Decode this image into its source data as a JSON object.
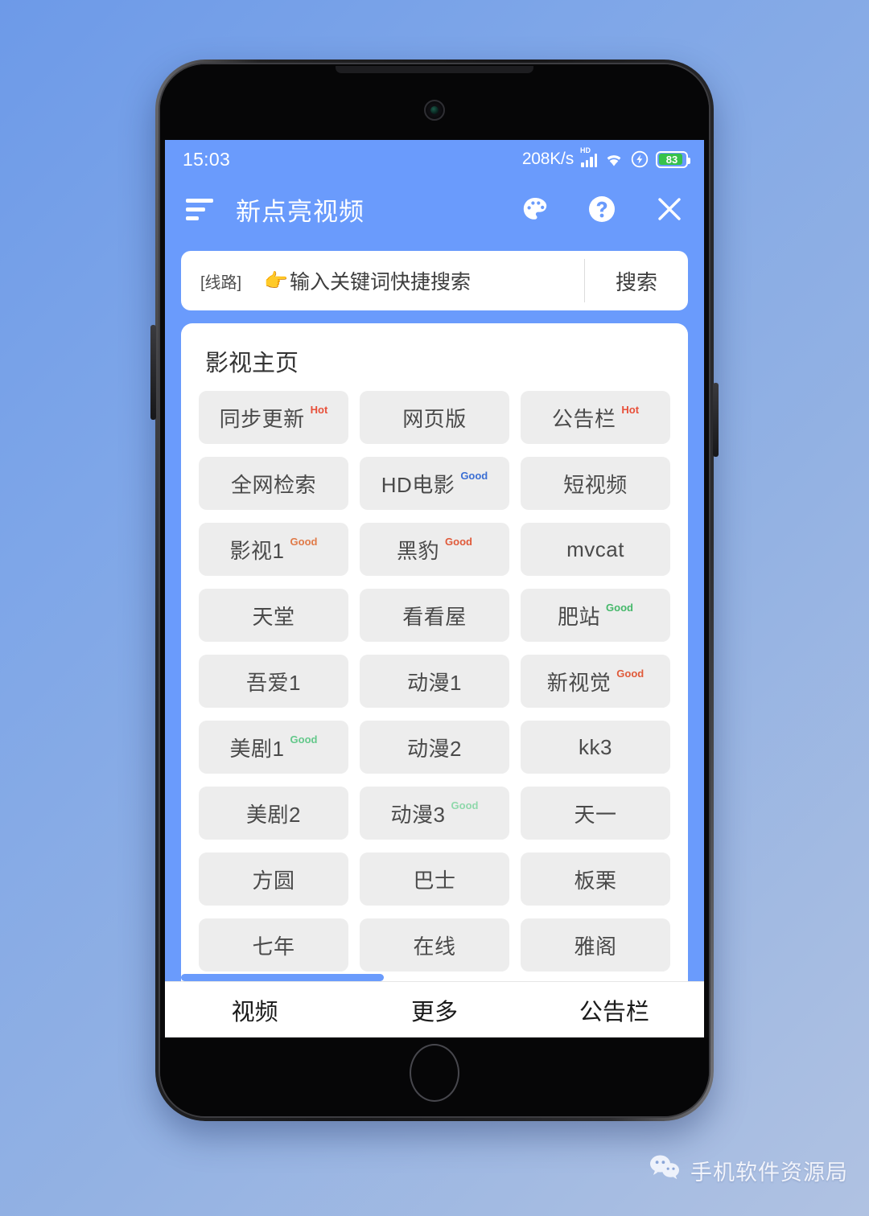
{
  "status_bar": {
    "time": "15:03",
    "network_speed": "208K/s",
    "signal_label": "HD",
    "battery_level": "83",
    "icons": [
      "signal-icon",
      "wifi-icon",
      "charging-icon",
      "battery-icon"
    ]
  },
  "app_bar": {
    "menu_icon": "sort-menu-icon",
    "title": "新点亮视频",
    "actions": [
      {
        "name": "palette-icon",
        "label": "主题"
      },
      {
        "name": "help-icon",
        "label": "帮助"
      },
      {
        "name": "close-icon",
        "label": "关闭"
      }
    ]
  },
  "search": {
    "route_label": "[线路]",
    "hand_emoji": "👉",
    "placeholder": "输入关键词快捷搜索",
    "value": "",
    "button_label": "搜索"
  },
  "content": {
    "section_title": "影视主页",
    "tiles": [
      {
        "label": "同步更新",
        "badge": "Hot",
        "badge_color": "#e8503a"
      },
      {
        "label": "网页版",
        "badge": "",
        "badge_color": ""
      },
      {
        "label": "公告栏",
        "badge": "Hot",
        "badge_color": "#e8503a"
      },
      {
        "label": "全网检索",
        "badge": "",
        "badge_color": ""
      },
      {
        "label": "HD电影",
        "badge": "Good",
        "badge_color": "#3b6fd4"
      },
      {
        "label": "短视频",
        "badge": "",
        "badge_color": ""
      },
      {
        "label": "影视1",
        "badge": "Good",
        "badge_color": "#e07a48"
      },
      {
        "label": "黑豹",
        "badge": "Good",
        "badge_color": "#e05a3a"
      },
      {
        "label": "mvcat",
        "badge": "",
        "badge_color": ""
      },
      {
        "label": "天堂",
        "badge": "",
        "badge_color": ""
      },
      {
        "label": "看看屋",
        "badge": "",
        "badge_color": ""
      },
      {
        "label": "肥站",
        "badge": "Good",
        "badge_color": "#45b86a"
      },
      {
        "label": "吾爱1",
        "badge": "",
        "badge_color": ""
      },
      {
        "label": "动漫1",
        "badge": "",
        "badge_color": ""
      },
      {
        "label": "新视觉",
        "badge": "Good",
        "badge_color": "#e05a3a"
      },
      {
        "label": "美剧1",
        "badge": "Good",
        "badge_color": "#63c88a"
      },
      {
        "label": "动漫2",
        "badge": "",
        "badge_color": ""
      },
      {
        "label": "kk3",
        "badge": "",
        "badge_color": ""
      },
      {
        "label": "美剧2",
        "badge": "",
        "badge_color": ""
      },
      {
        "label": "动漫3",
        "badge": "Good",
        "badge_color": "#8fd8ab"
      },
      {
        "label": "天一",
        "badge": "",
        "badge_color": ""
      },
      {
        "label": "方圆",
        "badge": "",
        "badge_color": ""
      },
      {
        "label": "巴士",
        "badge": "",
        "badge_color": ""
      },
      {
        "label": "板栗",
        "badge": "",
        "badge_color": ""
      },
      {
        "label": "七年",
        "badge": "",
        "badge_color": ""
      },
      {
        "label": "在线",
        "badge": "",
        "badge_color": ""
      },
      {
        "label": "雅阁",
        "badge": "",
        "badge_color": ""
      }
    ],
    "scroll_thumb_percent": "40"
  },
  "bottom_nav": {
    "items": [
      {
        "label": "视频",
        "name": "nav-video"
      },
      {
        "label": "更多",
        "name": "nav-more"
      },
      {
        "label": "公告栏",
        "name": "nav-bulletin"
      }
    ]
  },
  "watermark": {
    "icon": "wechat-icon",
    "text": "手机软件资源局"
  },
  "colors": {
    "app_blue": "#6a9bfc",
    "tile_bg": "#ededed",
    "battery_green": "#36c24a",
    "page_bg_start": "#6d9ae8",
    "page_bg_end": "#b0c2e2"
  }
}
